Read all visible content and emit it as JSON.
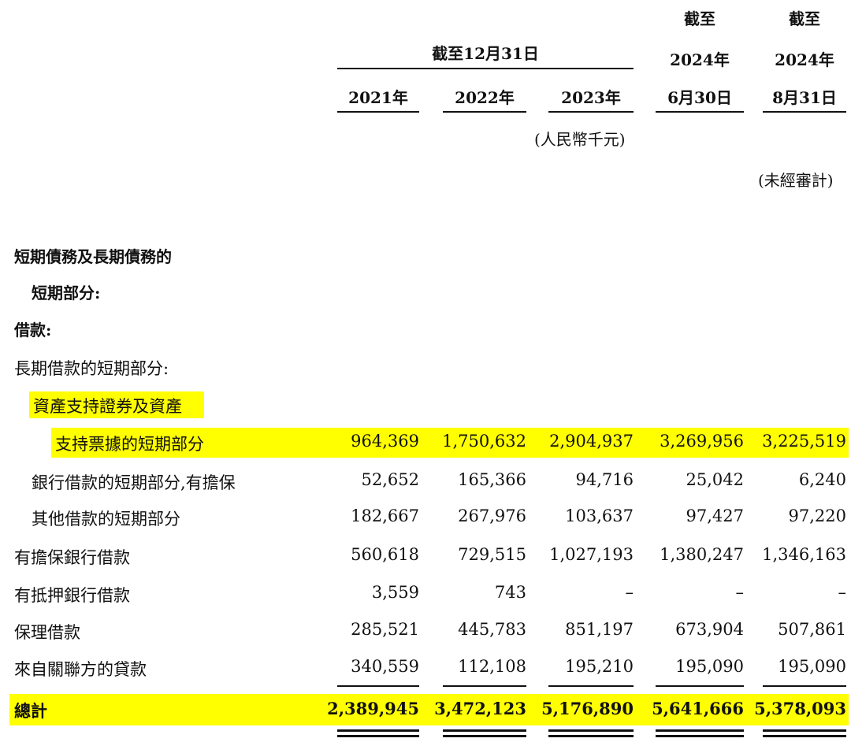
{
  "header": {
    "group_label": "截至12月31日",
    "col_2021": "2021年",
    "col_2022": "2022年",
    "col_2023": "2023年",
    "col_jun_l1": "截至",
    "col_jun_l2": "2024年",
    "col_jun_l3": "6月30日",
    "col_aug_l1": "截至",
    "col_aug_l2": "2024年",
    "col_aug_l3": "8月31日",
    "unit_note": "(人民幣千元)",
    "unaudited_note": "(未經審計)"
  },
  "labels": {
    "section1_l1": "短期債務及長期債務的",
    "section1_l2": "短期部分:",
    "loans": "借款:",
    "long_term_current": "長期借款的短期部分:",
    "abs_l1": "資產支持證券及資產",
    "abs_l2": "支持票據的短期部分",
    "bank_secured": "銀行借款的短期部分,有擔保",
    "other_loans": "其他借款的短期部分",
    "secured_bank": "有擔保銀行借款",
    "mortgage_bank": "有抵押銀行借款",
    "factoring": "保理借款",
    "related_party": "來自關聯方的貸款",
    "total": "總計"
  },
  "rows": {
    "abs": [
      "964,369",
      "1,750,632",
      "2,904,937",
      "3,269,956",
      "3,225,519"
    ],
    "bank_secured": [
      "52,652",
      "165,366",
      "94,716",
      "25,042",
      "6,240"
    ],
    "other_loans": [
      "182,667",
      "267,976",
      "103,637",
      "97,427",
      "97,220"
    ],
    "secured_bank": [
      "560,618",
      "729,515",
      "1,027,193",
      "1,380,247",
      "1,346,163"
    ],
    "mortgage_bank": [
      "3,559",
      "743",
      "–",
      "–",
      "–"
    ],
    "factoring": [
      "285,521",
      "445,783",
      "851,197",
      "673,904",
      "507,861"
    ],
    "related_party": [
      "340,559",
      "112,108",
      "195,210",
      "195,090",
      "195,090"
    ],
    "total": [
      "2,389,945",
      "3,472,123",
      "5,176,890",
      "5,641,666",
      "5,378,093"
    ]
  },
  "colors": {
    "highlight": "#ffff00",
    "text": "#111111"
  }
}
